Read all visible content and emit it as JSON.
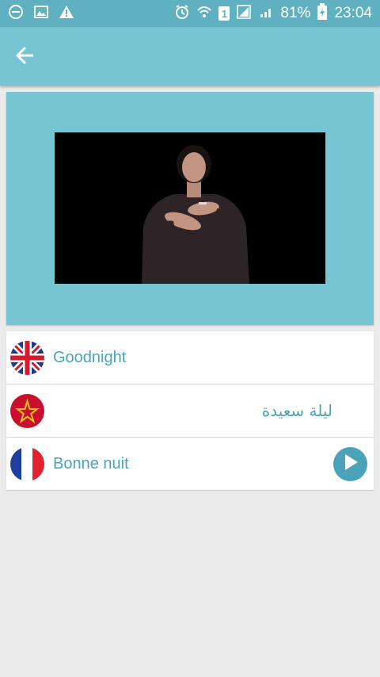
{
  "status_bar": {
    "battery_percent": "81%",
    "time": "23:04",
    "sim_label": "1",
    "icons": [
      "do-not-disturb-icon",
      "image-icon",
      "warning-icon",
      "alarm-icon",
      "wifi-icon",
      "sim-icon",
      "signal-icon",
      "signal-icon",
      "battery-charging-icon"
    ]
  },
  "app_bar": {
    "back_icon": "arrow-left-icon"
  },
  "video": {
    "content": "sign-language-video"
  },
  "translations": [
    {
      "flag": "uk-flag-icon",
      "text": "Goodnight"
    },
    {
      "flag": "morocco-flag-icon",
      "text": "ليلة سعيدة"
    },
    {
      "flag": "france-flag-icon",
      "text": "Bonne nuit"
    }
  ],
  "colors": {
    "status_bar": "#5fb0c0",
    "app_bar": "#77c5d3",
    "accent": "#4aa3b8",
    "background": "#ebebeb"
  }
}
